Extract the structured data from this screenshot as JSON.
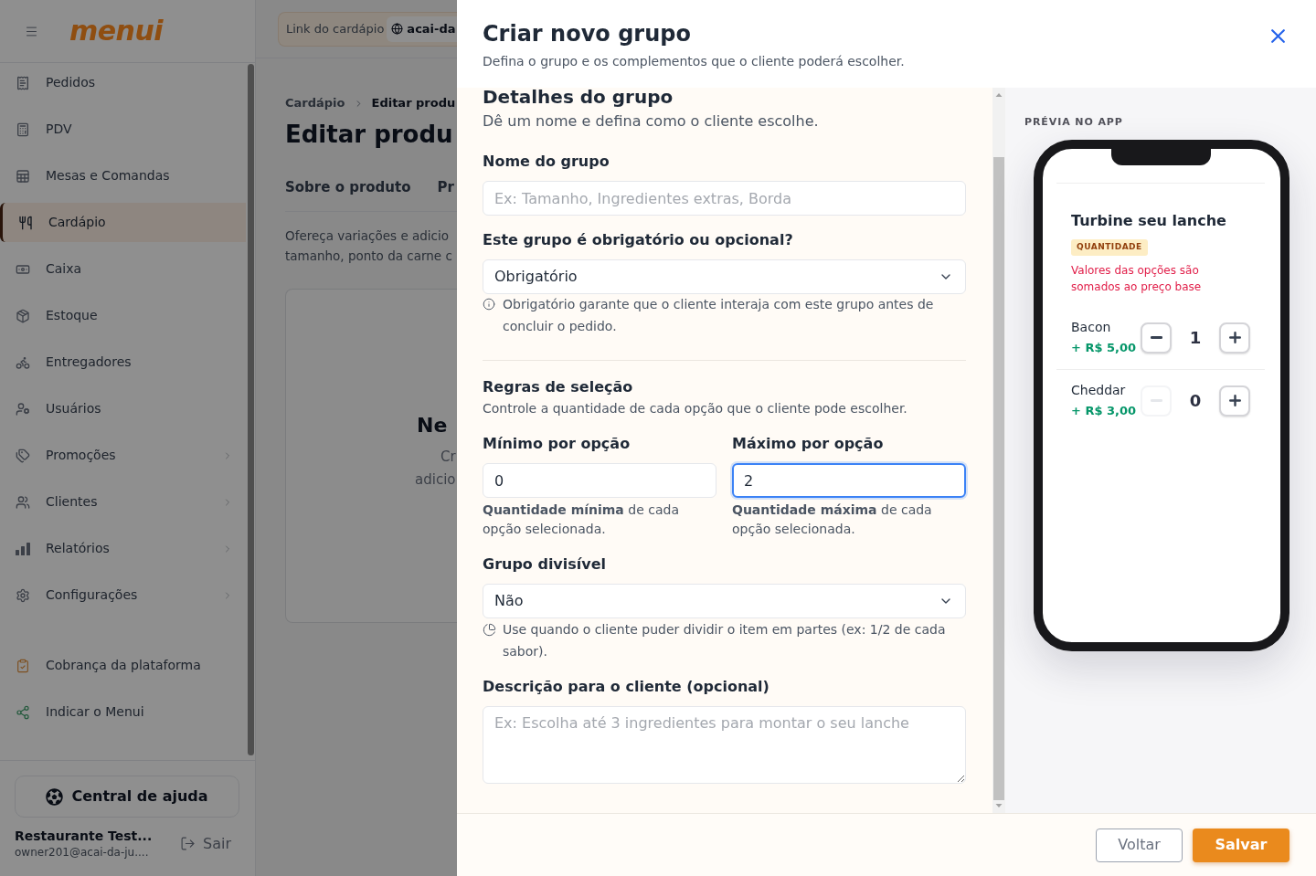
{
  "sidebar": {
    "logo": "menui",
    "items": [
      {
        "label": "Pedidos",
        "selected": false,
        "has_submenu": false
      },
      {
        "label": "PDV",
        "selected": false,
        "has_submenu": false
      },
      {
        "label": "Mesas e Comandas",
        "selected": false,
        "has_submenu": false
      },
      {
        "label": "Cardápio",
        "selected": true,
        "has_submenu": false
      },
      {
        "label": "Caixa",
        "selected": false,
        "has_submenu": false
      },
      {
        "label": "Estoque",
        "selected": false,
        "has_submenu": false
      },
      {
        "label": "Entregadores",
        "selected": false,
        "has_submenu": false
      },
      {
        "label": "Usuários",
        "selected": false,
        "has_submenu": false
      },
      {
        "label": "Promoções",
        "selected": false,
        "has_submenu": true
      },
      {
        "label": "Clientes",
        "selected": false,
        "has_submenu": true
      },
      {
        "label": "Relatórios",
        "selected": false,
        "has_submenu": true
      },
      {
        "label": "Configurações",
        "selected": false,
        "has_submenu": true
      }
    ],
    "secondary_items": [
      {
        "label": "Cobrança da plataforma"
      },
      {
        "label": "Indicar o Menui"
      }
    ],
    "help_button": "Central de ajuda",
    "account": {
      "name": "Restaurante Test...",
      "email": "owner201@acai-da-ju....",
      "logout": "Sair"
    }
  },
  "background_page": {
    "menu_link": {
      "label": "Link do cardápio",
      "value": "acai-da"
    },
    "breadcrumb": [
      "Cardápio",
      "Editar produ"
    ],
    "title": "Editar produ",
    "tabs": [
      "Sobre o produto",
      "Pr"
    ],
    "description": [
      "Ofereça variações e adicio",
      "tamanho, ponto da carne c"
    ],
    "empty_state": {
      "title": "Ne",
      "lines": [
        "Cr",
        "adicio"
      ]
    }
  },
  "modal": {
    "title": "Criar novo grupo",
    "subtitle": "Defina o grupo e os complementos que o cliente poderá escolher.",
    "section": {
      "title": "Detalhes do grupo",
      "subtitle": "Dê um nome e defina como o cliente escolhe."
    },
    "name_field": {
      "label": "Nome do grupo",
      "placeholder": "Ex: Tamanho, Ingredientes extras, Borda"
    },
    "required_field": {
      "label": "Este grupo é obrigatório ou opcional?",
      "value": "Obrigatório",
      "hint": "Obrigatório garante que o cliente interaja com este grupo antes de concluir o pedido."
    },
    "rules": {
      "title": "Regras de seleção",
      "subtitle": "Controle a quantidade de cada opção que o cliente pode escolher.",
      "fields": [
        {
          "label": "Mínimo por opção",
          "value": "0",
          "focused": false,
          "hint": "**Quantidade mínima** de cada opção selecionada."
        },
        {
          "label": "Máximo por opção",
          "value": "2",
          "focused": true,
          "hint": "**Quantidade máxima** de cada opção selecionada."
        }
      ]
    },
    "divisible_field": {
      "label": "Grupo divisível",
      "value": "Não",
      "hint": "Use quando o cliente puder dividir o item em partes (ex: 1/2 de cada sabor)."
    },
    "description_field": {
      "label": "Descrição para o cliente (opcional)",
      "placeholder": "Ex: Escolha até 3 ingredientes para montar o seu lanche"
    },
    "buttons": {
      "back": "Voltar",
      "save": "Salvar"
    }
  },
  "preview": {
    "label": "PRÉVIA NO APP",
    "group_title": "Turbine seu lanche",
    "badge": "QUANTIDADE",
    "note": "Valores das opções são somados ao preço base",
    "options": [
      {
        "name": "Bacon",
        "price": "+ R$ 5,00",
        "quantity": "1",
        "decrease_disabled": false
      },
      {
        "name": "Cheddar",
        "price": "+ R$ 3,00",
        "quantity": "0",
        "decrease_disabled": true
      }
    ]
  }
}
